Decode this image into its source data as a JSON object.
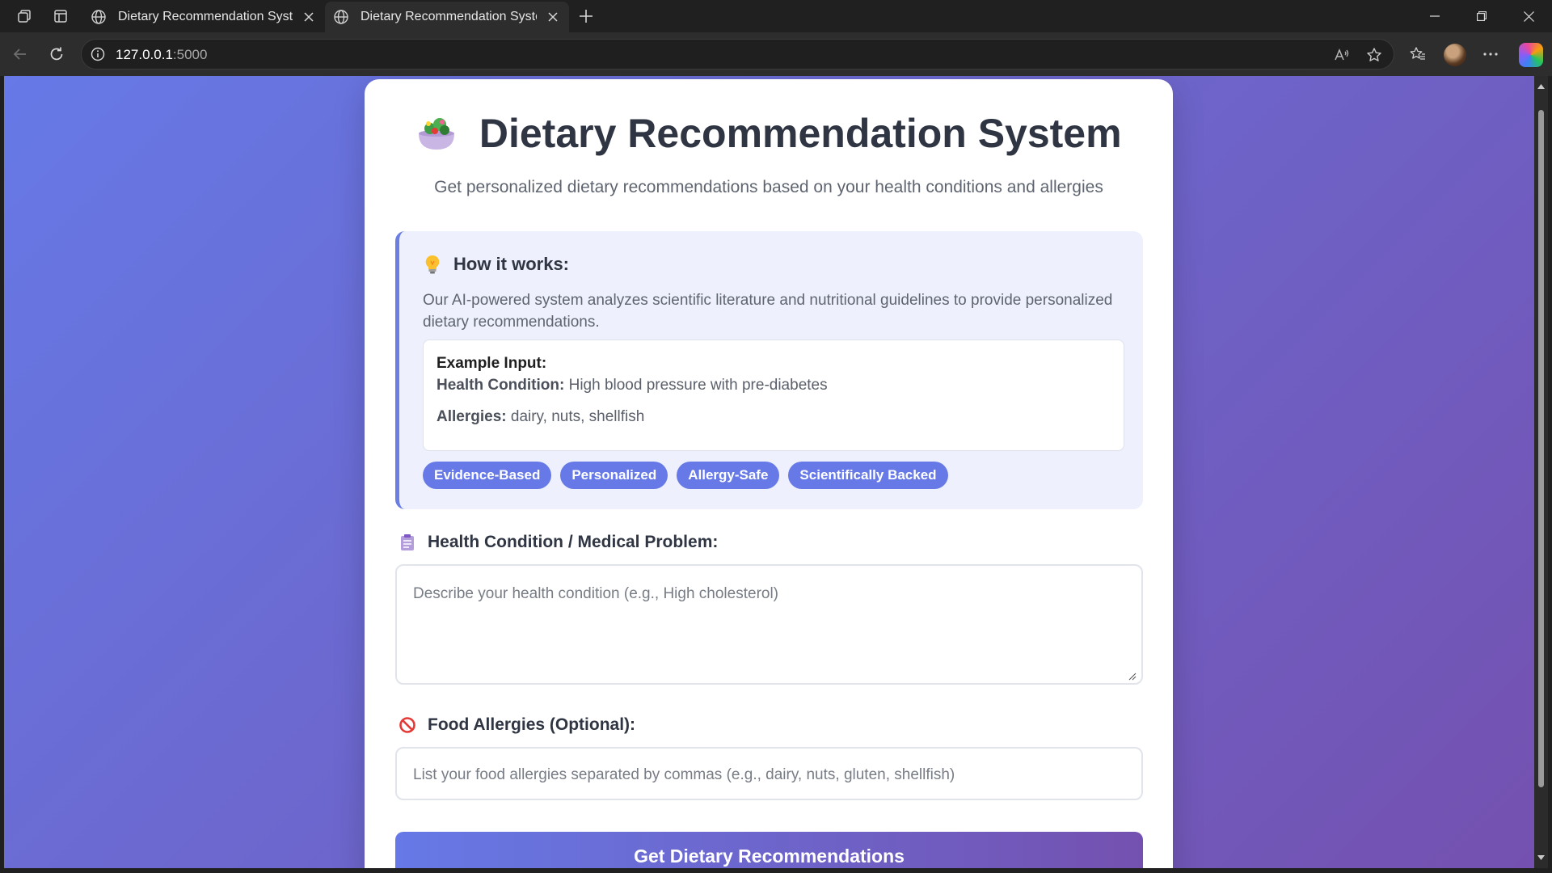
{
  "browser": {
    "tabs": [
      {
        "title": "Dietary Recommendation System",
        "active": false
      },
      {
        "title": "Dietary Recommendation System",
        "active": true
      }
    ],
    "url_host": "127.0.0.1",
    "url_port": ":5000"
  },
  "page": {
    "title": "Dietary Recommendation System",
    "subtitle": "Get personalized dietary recommendations based on your health conditions and allergies",
    "how_it_works": {
      "heading": "How it works:",
      "description": "Our AI-powered system analyzes scientific literature and nutritional guidelines to provide personalized dietary recommendations.",
      "example": {
        "heading": "Example Input:",
        "condition_label": "Health Condition:",
        "condition_value": "High blood pressure with pre-diabetes",
        "allergies_label": "Allergies:",
        "allergies_value": "dairy, nuts, shellfish"
      },
      "tags": [
        "Evidence-Based",
        "Personalized",
        "Allergy-Safe",
        "Scientifically Backed"
      ]
    },
    "health_field": {
      "label": "Health Condition / Medical Problem:",
      "placeholder": "Describe your health condition (e.g., High cholesterol)",
      "value": ""
    },
    "allergy_field": {
      "label": "Food Allergies (Optional):",
      "placeholder": "List your food allergies separated by commas (e.g., dairy, nuts, gluten, shellfish)",
      "value": ""
    },
    "submit_label": "Get Dietary Recommendations"
  },
  "colors": {
    "gradient_start": "#6679e6",
    "gradient_end": "#7451b0",
    "tag_bg": "#6679e6",
    "info_box_bg": "#eef1fd"
  },
  "icons": {
    "title": "salad-bowl-icon",
    "how_it_works": "light-bulb-icon",
    "health_field": "clipboard-icon",
    "allergy_field": "prohibited-icon"
  }
}
